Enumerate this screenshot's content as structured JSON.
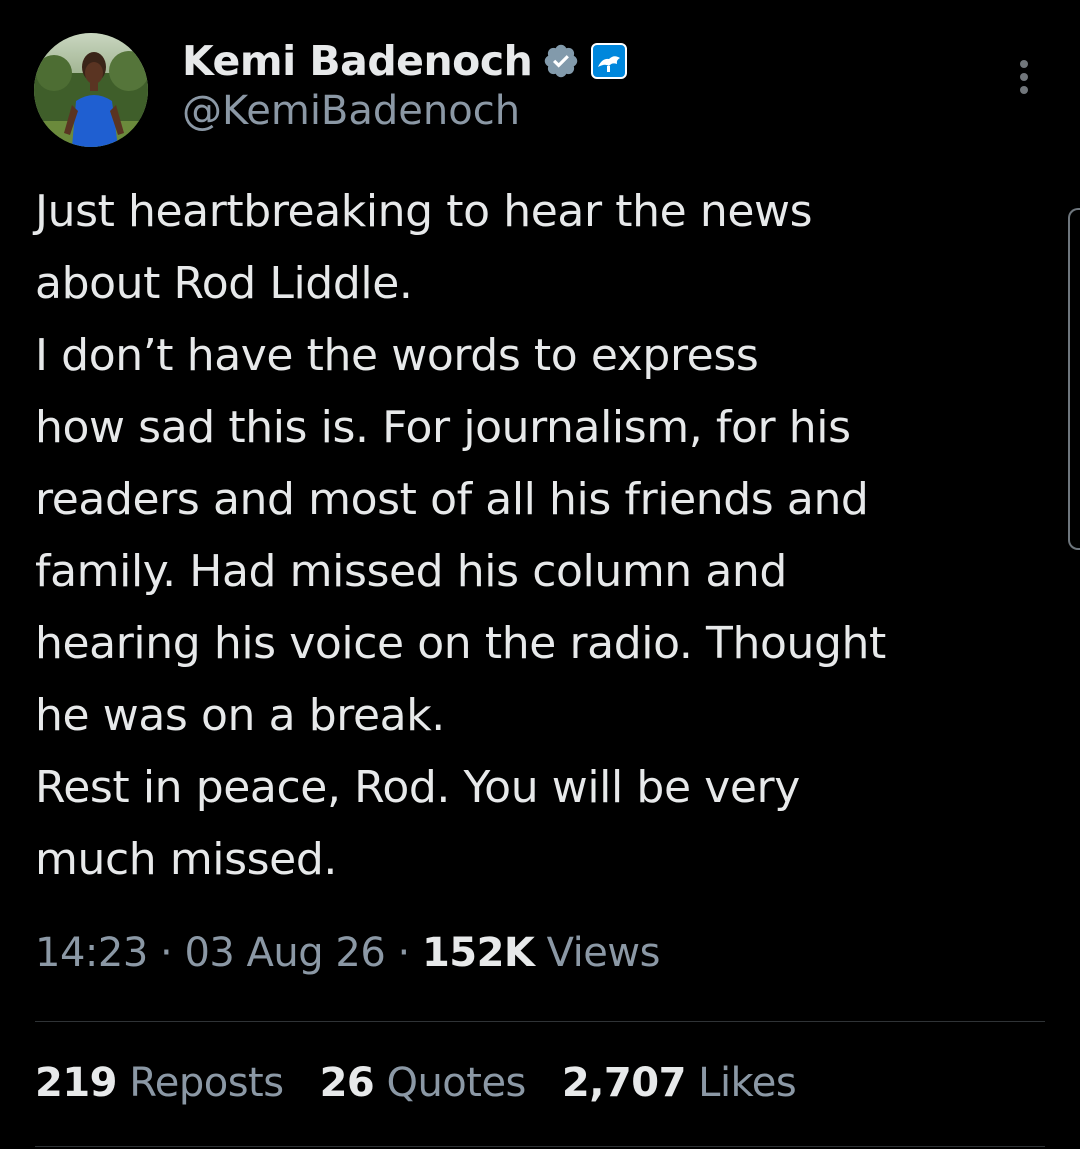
{
  "author": {
    "display_name": "Kemi Badenoch",
    "handle": "@KemiBadenoch",
    "verified_color": "#829aab",
    "affiliation_badge_color": "#0087dc"
  },
  "text_lines": [
    "Just heartbreaking to hear the news",
    "about Rod Liddle.",
    "I don’t have the words to express",
    "how sad this is. For journalism, for his",
    "readers and most of all his friends and",
    "family. Had missed his column and",
    "hearing his voice on the radio. Thought",
    "he was on a break.",
    "Rest in peace, Rod. You will be very",
    "much missed."
  ],
  "meta": {
    "time": "14:23",
    "separator": "·",
    "date": "03 Aug 26",
    "views_count": "152K",
    "views_label": "Views"
  },
  "stats": {
    "reposts_count": "219",
    "reposts_label": "Reposts",
    "quotes_count": "26",
    "quotes_label": "Quotes",
    "likes_count": "2,707",
    "likes_label": "Likes"
  },
  "icons": {
    "verified": "verified-badge-icon",
    "affiliation": "party-affiliation-icon",
    "more": "more-options-icon"
  }
}
